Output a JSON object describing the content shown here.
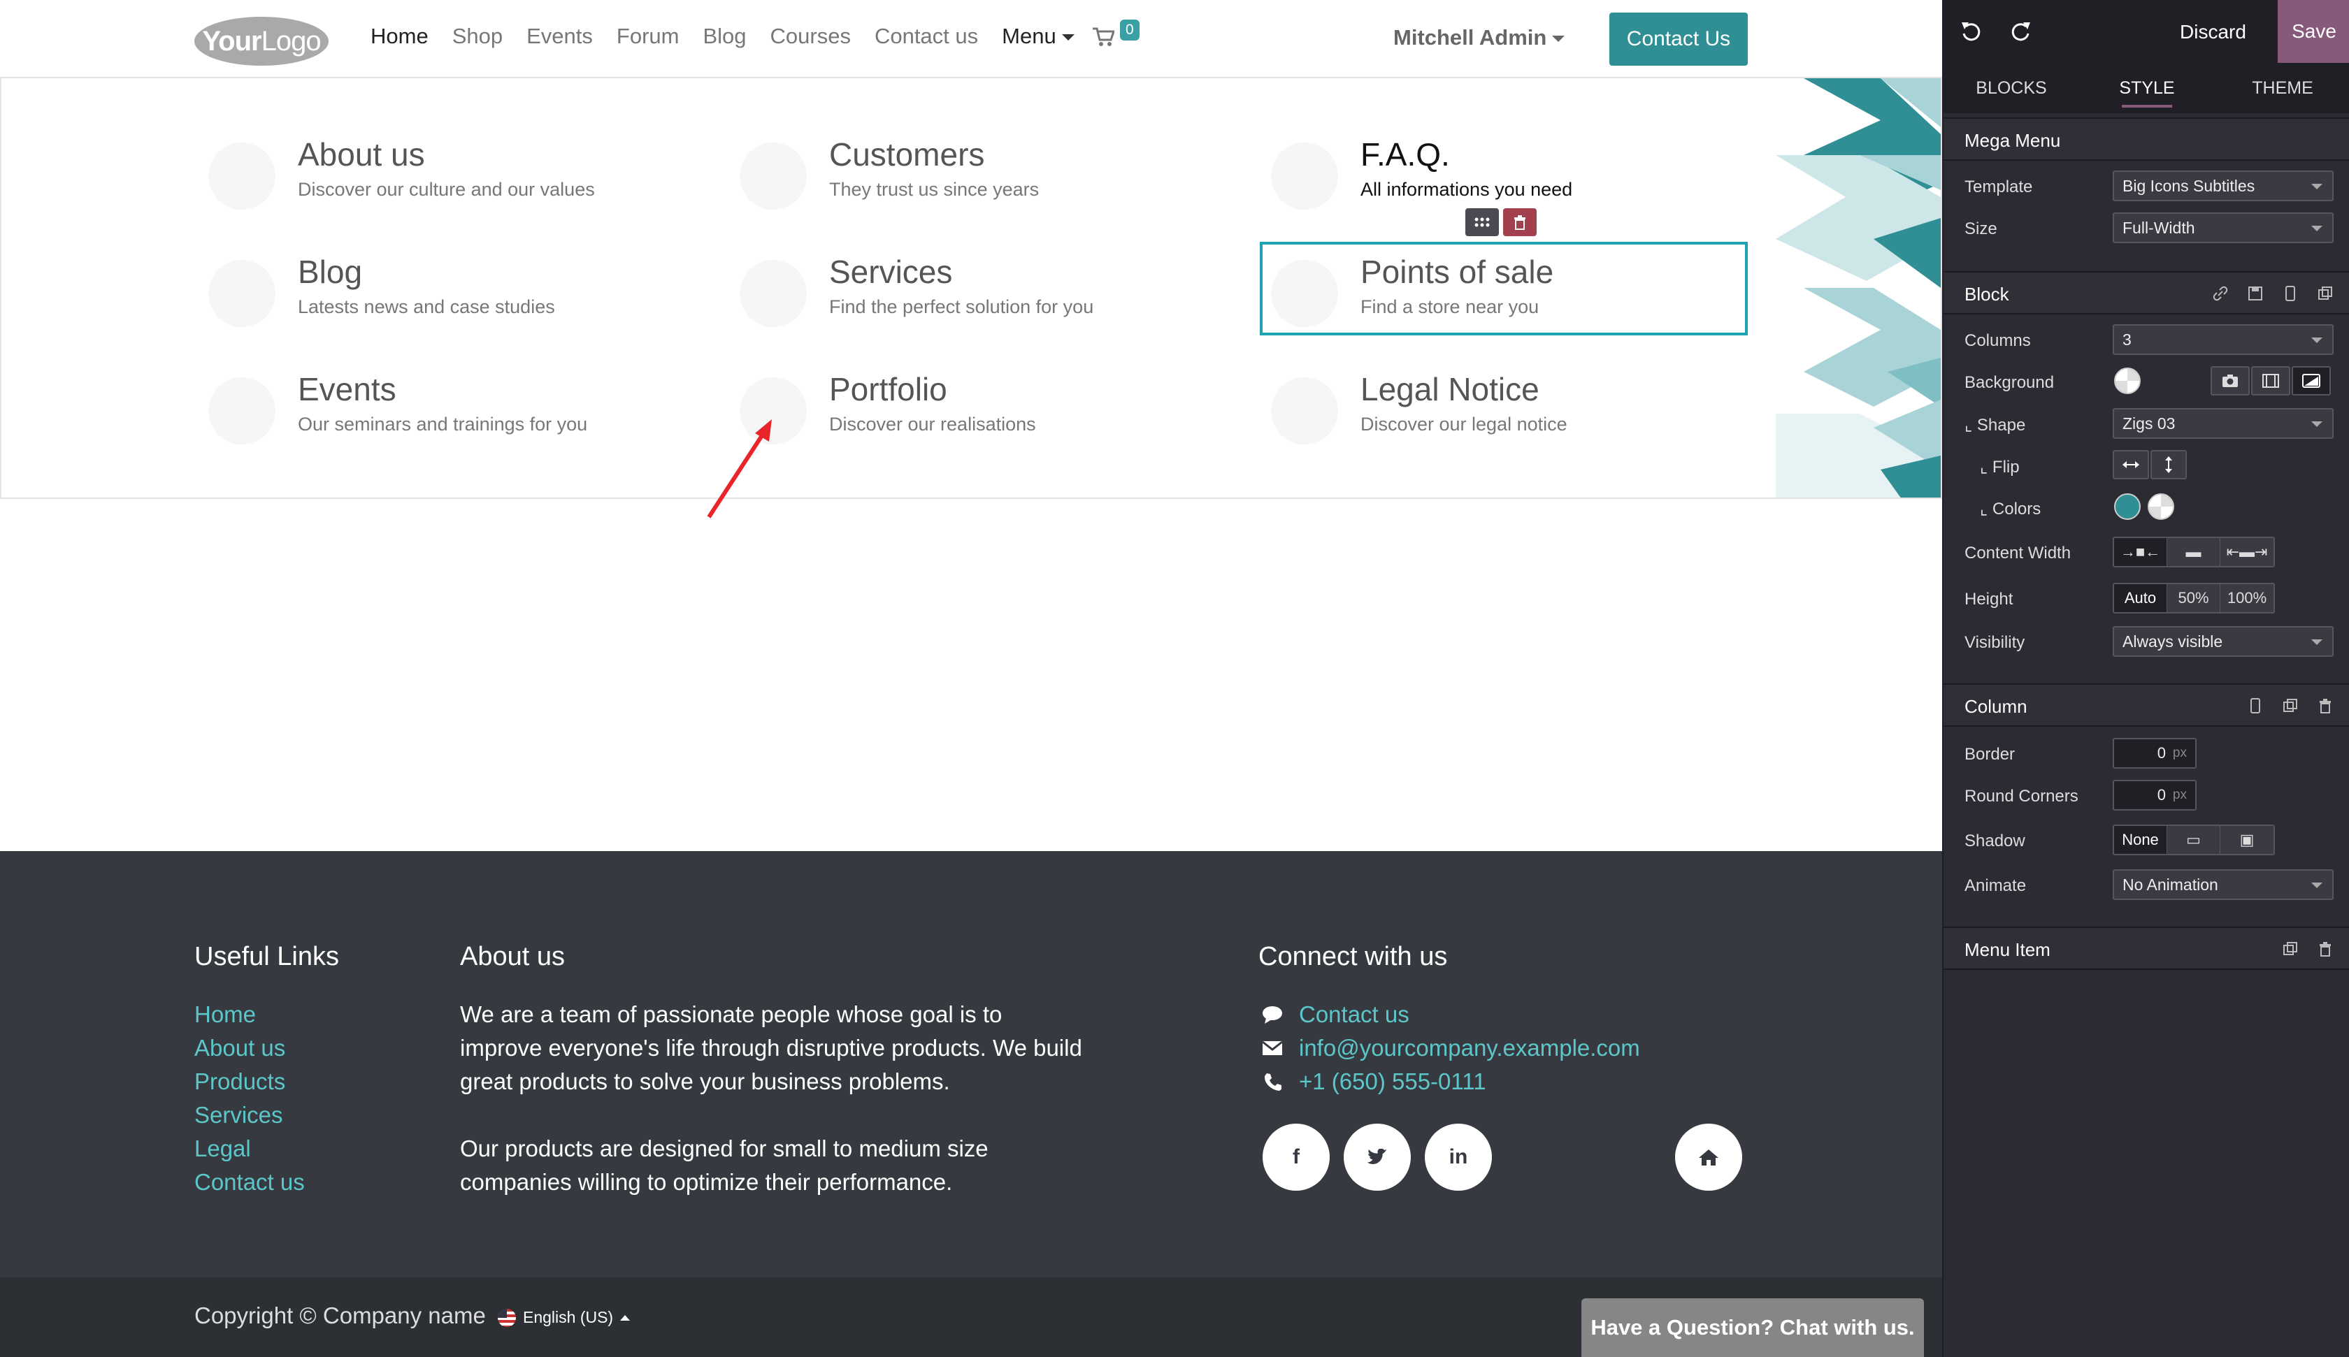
{
  "header": {
    "logo_part1": "Your",
    "logo_part2": "Logo",
    "nav": [
      "Home",
      "Shop",
      "Events",
      "Forum",
      "Blog",
      "Courses",
      "Contact us"
    ],
    "menu_label": "Menu",
    "cart_count": "0",
    "user": "Mitchell Admin",
    "contact_button": "Contact Us"
  },
  "mega_menu": {
    "items": [
      {
        "title": "About us",
        "subtitle": "Discover our culture and our values"
      },
      {
        "title": "Customers",
        "subtitle": "They trust us since years"
      },
      {
        "title": "F.A.Q.",
        "subtitle": "All informations you need"
      },
      {
        "title": "Blog",
        "subtitle": "Latests news and case studies"
      },
      {
        "title": "Services",
        "subtitle": "Find the perfect solution for you"
      },
      {
        "title": "Points of sale",
        "subtitle": "Find a store near you"
      },
      {
        "title": "Events",
        "subtitle": "Our seminars and trainings for you"
      },
      {
        "title": "Portfolio",
        "subtitle": "Discover our realisations"
      },
      {
        "title": "Legal Notice",
        "subtitle": "Discover our legal notice"
      }
    ]
  },
  "footer": {
    "useful_links_title": "Useful Links",
    "links": [
      "Home",
      "About us",
      "Products",
      "Services",
      "Legal",
      "Contact us"
    ],
    "about_title": "About us",
    "about_p1": "We are a team of passionate people whose goal is to improve everyone's life through disruptive products. We build great products to solve your business problems.",
    "about_p2": "Our products are designed for small to medium size companies willing to optimize their performance.",
    "connect_title": "Connect with us",
    "contact_link": "Contact us",
    "email": "info@yourcompany.example.com",
    "phone": "+1 (650) 555-0111",
    "copyright": "Copyright © Company name",
    "language": "English (US)",
    "chat": "Have a Question? Chat with us."
  },
  "editor": {
    "discard": "Discard",
    "save": "Save",
    "tabs": [
      "BLOCKS",
      "STYLE",
      "THEME"
    ],
    "active_tab": "STYLE",
    "mega_menu_section": "Mega Menu",
    "template_label": "Template",
    "template_value": "Big Icons Subtitles",
    "size_label": "Size",
    "size_value": "Full-Width",
    "block_section": "Block",
    "columns_label": "Columns",
    "columns_value": "3",
    "background_label": "Background",
    "shape_label": "⌞ Shape",
    "shape_value": "Zigs 03",
    "flip_label": "⌞ Flip",
    "colors_label": "⌞ Colors",
    "content_width_label": "Content Width",
    "height_label": "Height",
    "height_options": [
      "Auto",
      "50%",
      "100%"
    ],
    "visibility_label": "Visibility",
    "visibility_value": "Always visible",
    "column_section": "Column",
    "border_label": "Border",
    "border_value": "0",
    "round_corners_label": "Round Corners",
    "round_corners_value": "0",
    "unit_px": "px",
    "shadow_label": "Shadow",
    "shadow_none": "None",
    "animate_label": "Animate",
    "animate_value": "No Animation",
    "menu_item_section": "Menu Item",
    "accent_color": "#875a7b",
    "teal_color": "#2f8f94"
  }
}
